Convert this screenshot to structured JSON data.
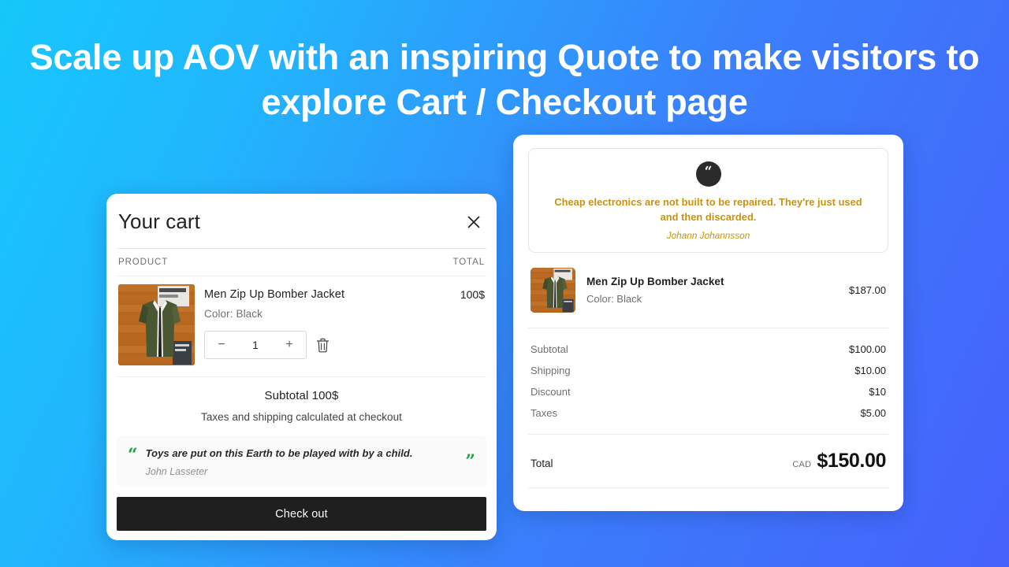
{
  "headline": {
    "accent_text": "Scale up AOV",
    "rest_text": " with an inspiring Quote to make visitors to explore Cart / Checkout page",
    "accent_color": "#1fe94a",
    "text_color": "#ffffff"
  },
  "background": {
    "gradient_from": "#16c7fb",
    "gradient_to": "#4661fb"
  },
  "cart": {
    "title": "Your cart",
    "close_icon": "close-icon",
    "columns": {
      "product": "PRODUCT",
      "total": "TOTAL"
    },
    "item": {
      "name": "Men Zip Up Bomber Jacket",
      "variant": "Color: Black",
      "line_total": "100$",
      "quantity": "1",
      "decrement_label": "−",
      "increment_label": "+",
      "remove_icon": "trash-icon",
      "thumbnail_alt": "olive green bomber jacket on wood"
    },
    "subtotal_label": "Subtotal 100$",
    "subtotal_note": "Taxes and shipping calculated at checkout",
    "quote": {
      "open_mark": "“",
      "close_mark": "”",
      "text": "Toys are put on this Earth to be played with by a child.",
      "author": "John Lasseter",
      "mark_color": "#1aa542"
    },
    "checkout_button": "Check out",
    "checkout_button_color": "#1f1f1f"
  },
  "checkout": {
    "quote": {
      "badge_icon": "quote-icon",
      "badge_glyph": "“",
      "badge_color": "#2b2b2b",
      "text": "Cheap electronics are not built to be repaired. They're just used and then discarded.",
      "author": "Johann Johannsson",
      "text_color": "#c8920f"
    },
    "item": {
      "name": "Men Zip Up Bomber Jacket",
      "variant": "Color: Black",
      "price": "$187.00",
      "thumbnail_alt": "olive green bomber jacket on wood"
    },
    "totals": [
      {
        "label": "Subtotal",
        "value": "$100.00"
      },
      {
        "label": "Shipping",
        "value": "$10.00"
      },
      {
        "label": "Discount",
        "value": "$10"
      },
      {
        "label": "Taxes",
        "value": "$5.00"
      }
    ],
    "total": {
      "label": "Total",
      "currency": "CAD",
      "amount": "$150.00"
    }
  }
}
